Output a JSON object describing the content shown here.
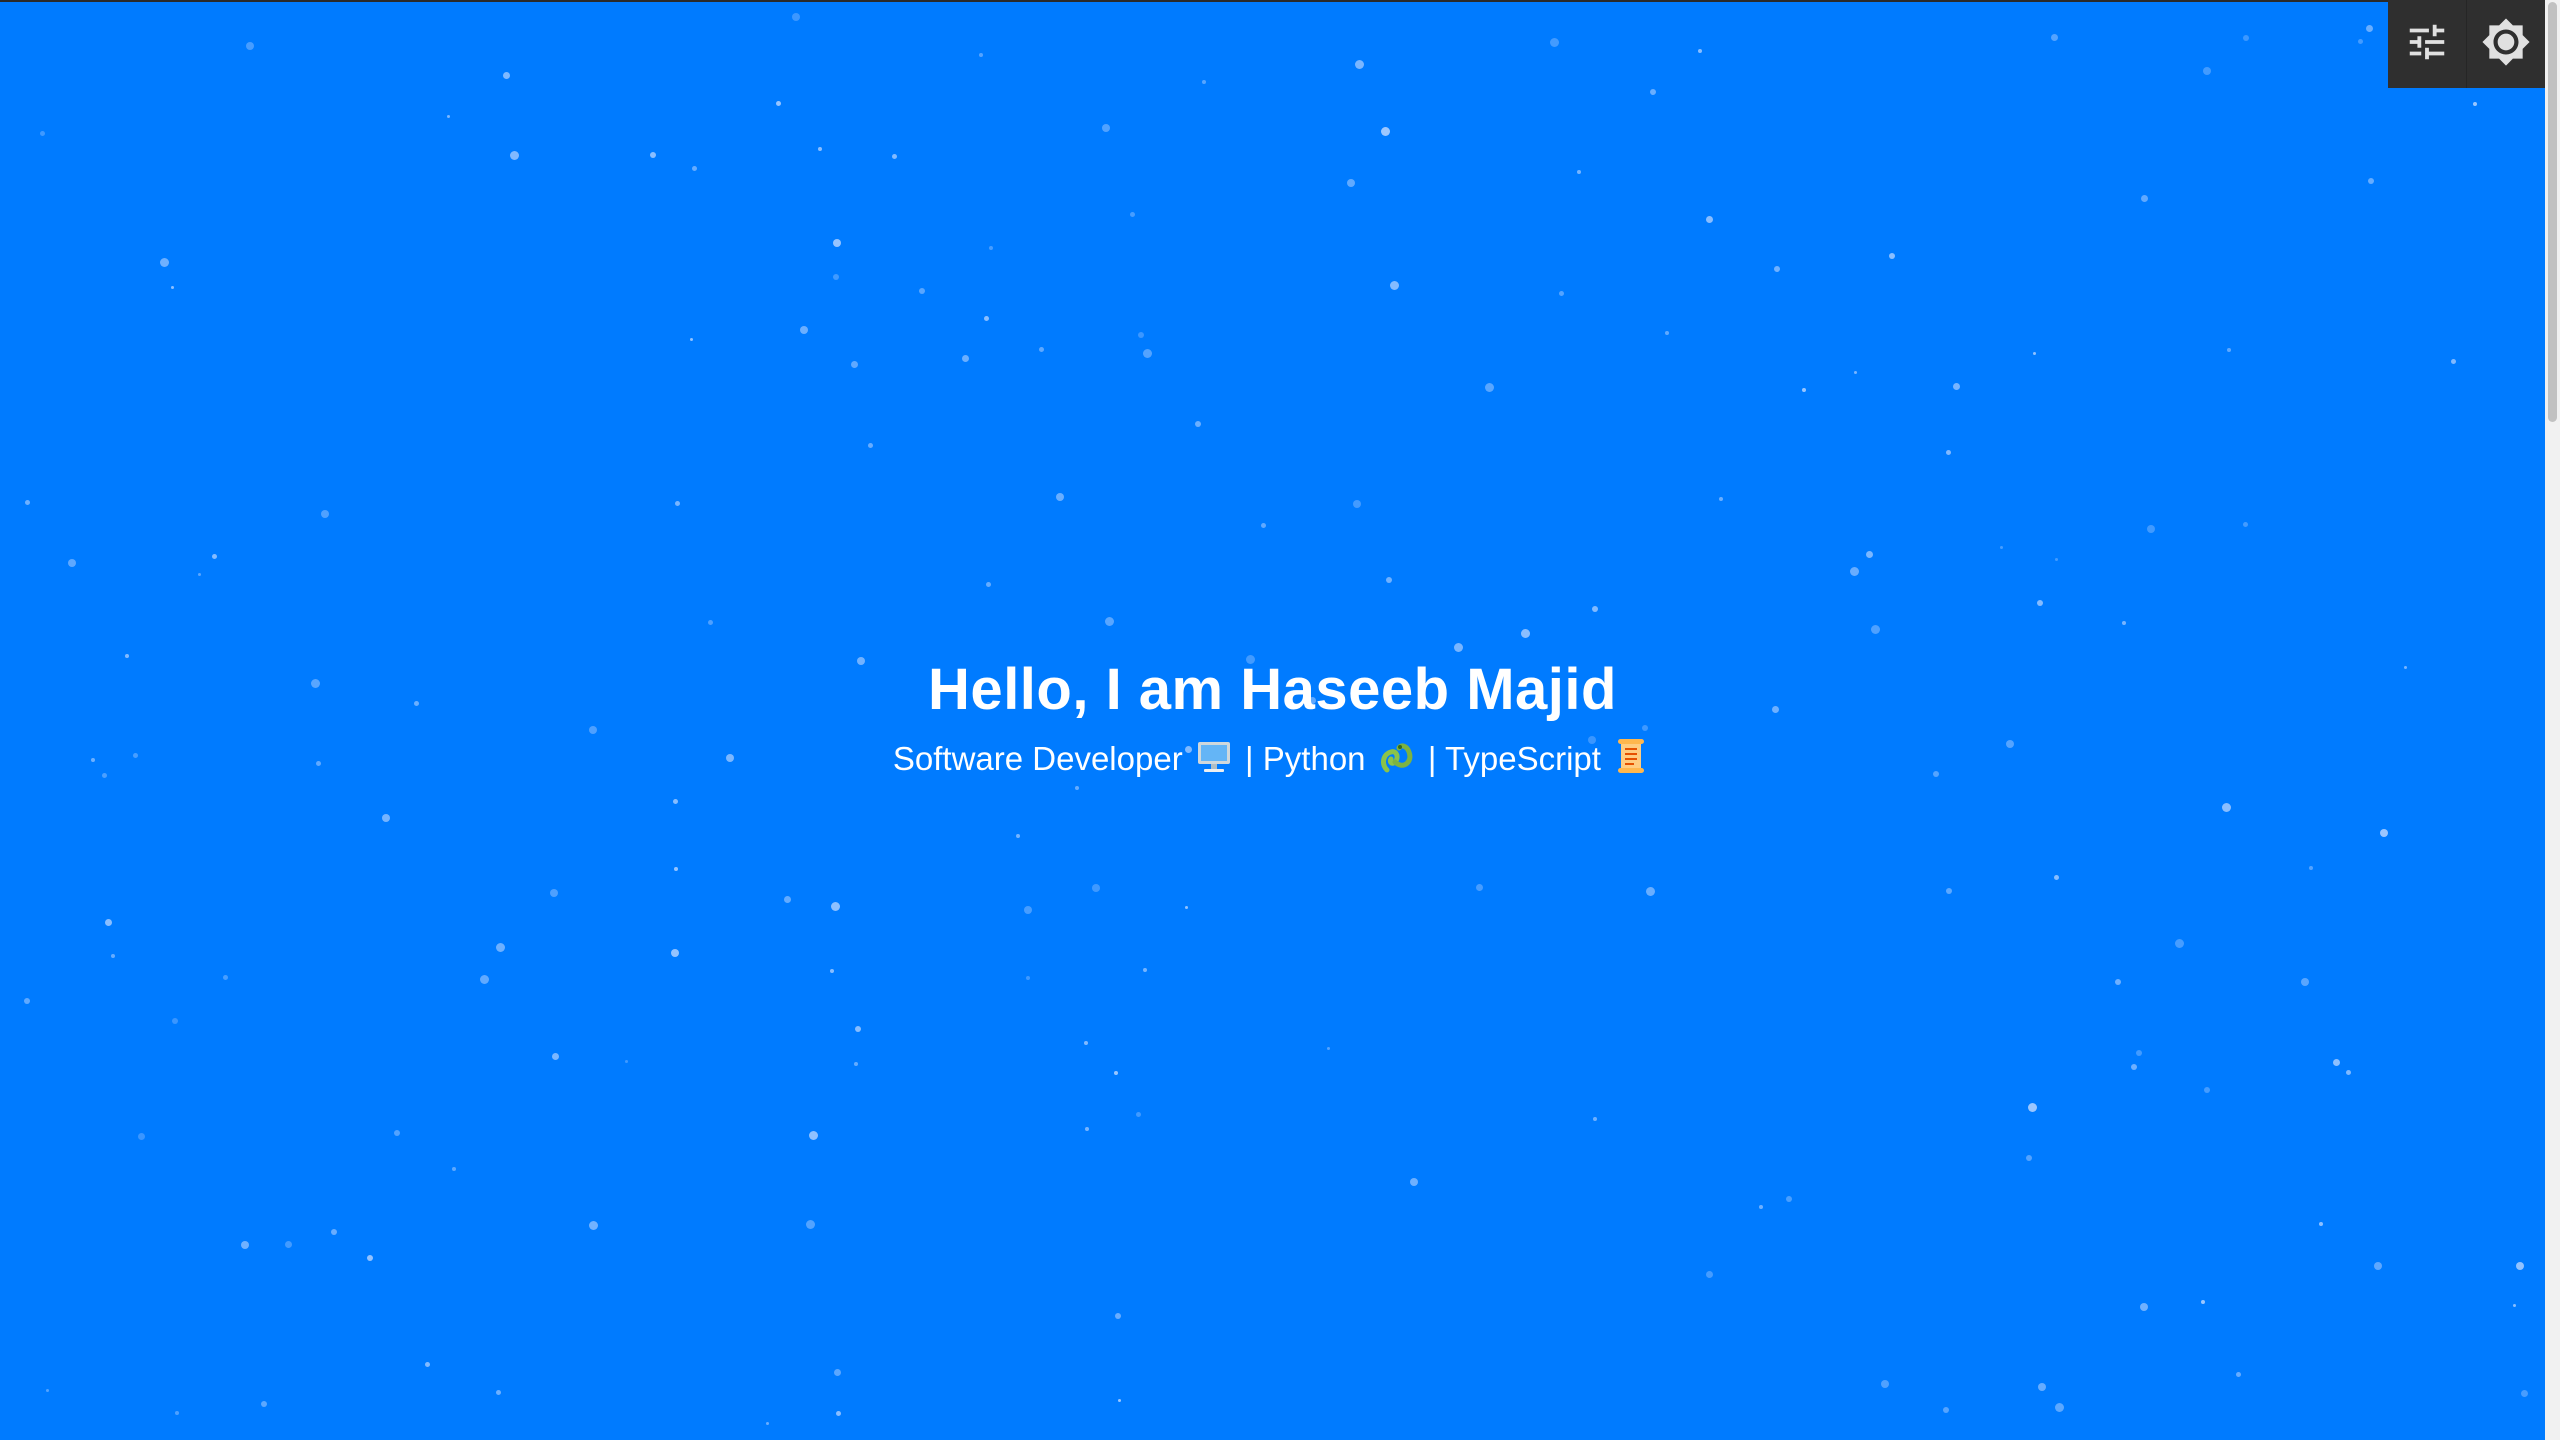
{
  "hero": {
    "title": "Hello, I am Haseeb Majid",
    "subtitle_parts": {
      "role": "Software Developer",
      "separator1": "|",
      "lang1": "Python",
      "separator2": "|",
      "lang2": "TypeScript"
    }
  },
  "toolbar": {
    "settings_icon": "sliders-icon",
    "theme_icon": "brightness-icon"
  },
  "colors": {
    "background": "#007BFF",
    "toolbar": "#2F2F2F",
    "toolbar_icon": "#E0E0E0",
    "text": "#FFFFFF",
    "particle": "#DCE6FF"
  }
}
